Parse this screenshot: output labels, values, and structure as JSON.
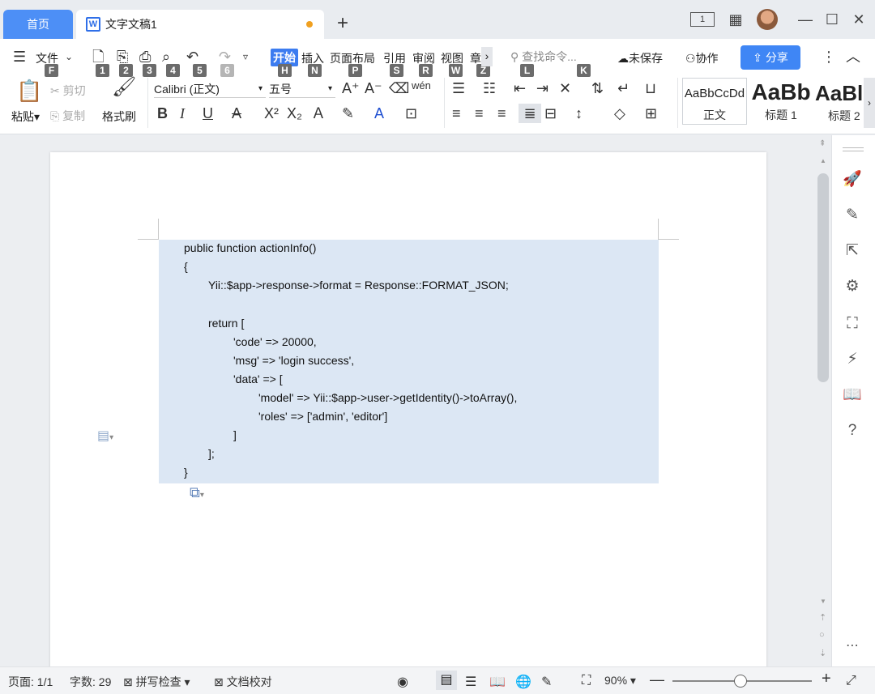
{
  "tabs": {
    "home": "首页",
    "document": "文字文稿1",
    "doc_icon": "W"
  },
  "window_controls": {
    "layout1": "1",
    "minimize": "—",
    "maximize": "☐",
    "close": "✕"
  },
  "menu": {
    "file": "文件",
    "file_key": "F",
    "quick_keys": [
      "1",
      "2",
      "3",
      "4",
      "5",
      "6"
    ],
    "start": "开始",
    "start_key": "H",
    "insert": "插入",
    "insert_key": "N",
    "layout": "页面布局",
    "layout_key": "P",
    "reference": "引用",
    "reference_key": "S",
    "review": "审阅",
    "review_key": "R",
    "view": "视图",
    "view_key": "W",
    "chapter": "章",
    "chapter_key": "Z",
    "more": "›",
    "search_placeholder": "查找命令...",
    "search_key": "L",
    "unsaved": "未保存",
    "collab": "协作",
    "collab_key": "K",
    "share": "分享"
  },
  "ribbon": {
    "paste": "粘贴",
    "cut": "剪切",
    "copy": "复制",
    "format_painter": "格式刷",
    "font_name": "Calibri (正文)",
    "font_size": "五号",
    "styles": [
      {
        "preview": "AaBbCcDd",
        "label": "正文"
      },
      {
        "preview": "AaBb",
        "label": "标题 1"
      },
      {
        "preview": "AaBl",
        "label": "标题 2"
      }
    ]
  },
  "document": {
    "code_lines": [
      "public function actionInfo()",
      "{",
      "Yii::$app->response->format = Response::FORMAT_JSON;",
      "",
      "return [",
      "'code' => 20000,",
      "'msg' => 'login success',",
      "'data' => [",
      "'model' => Yii::$app->user->getIdentity()->toArray(),",
      "'roles' => ['admin', 'editor']",
      "]",
      "];",
      "}"
    ]
  },
  "statusbar": {
    "page": "页面: 1/1",
    "word_count": "字数: 29",
    "spell_check": "拼写检查",
    "doc_proof": "文档校对",
    "zoom": "90%",
    "zoom_level_percent": 90
  },
  "colors": {
    "accent": "#3f86f5",
    "selection": "#dce7f4",
    "home_tab": "#4d8ff6"
  }
}
